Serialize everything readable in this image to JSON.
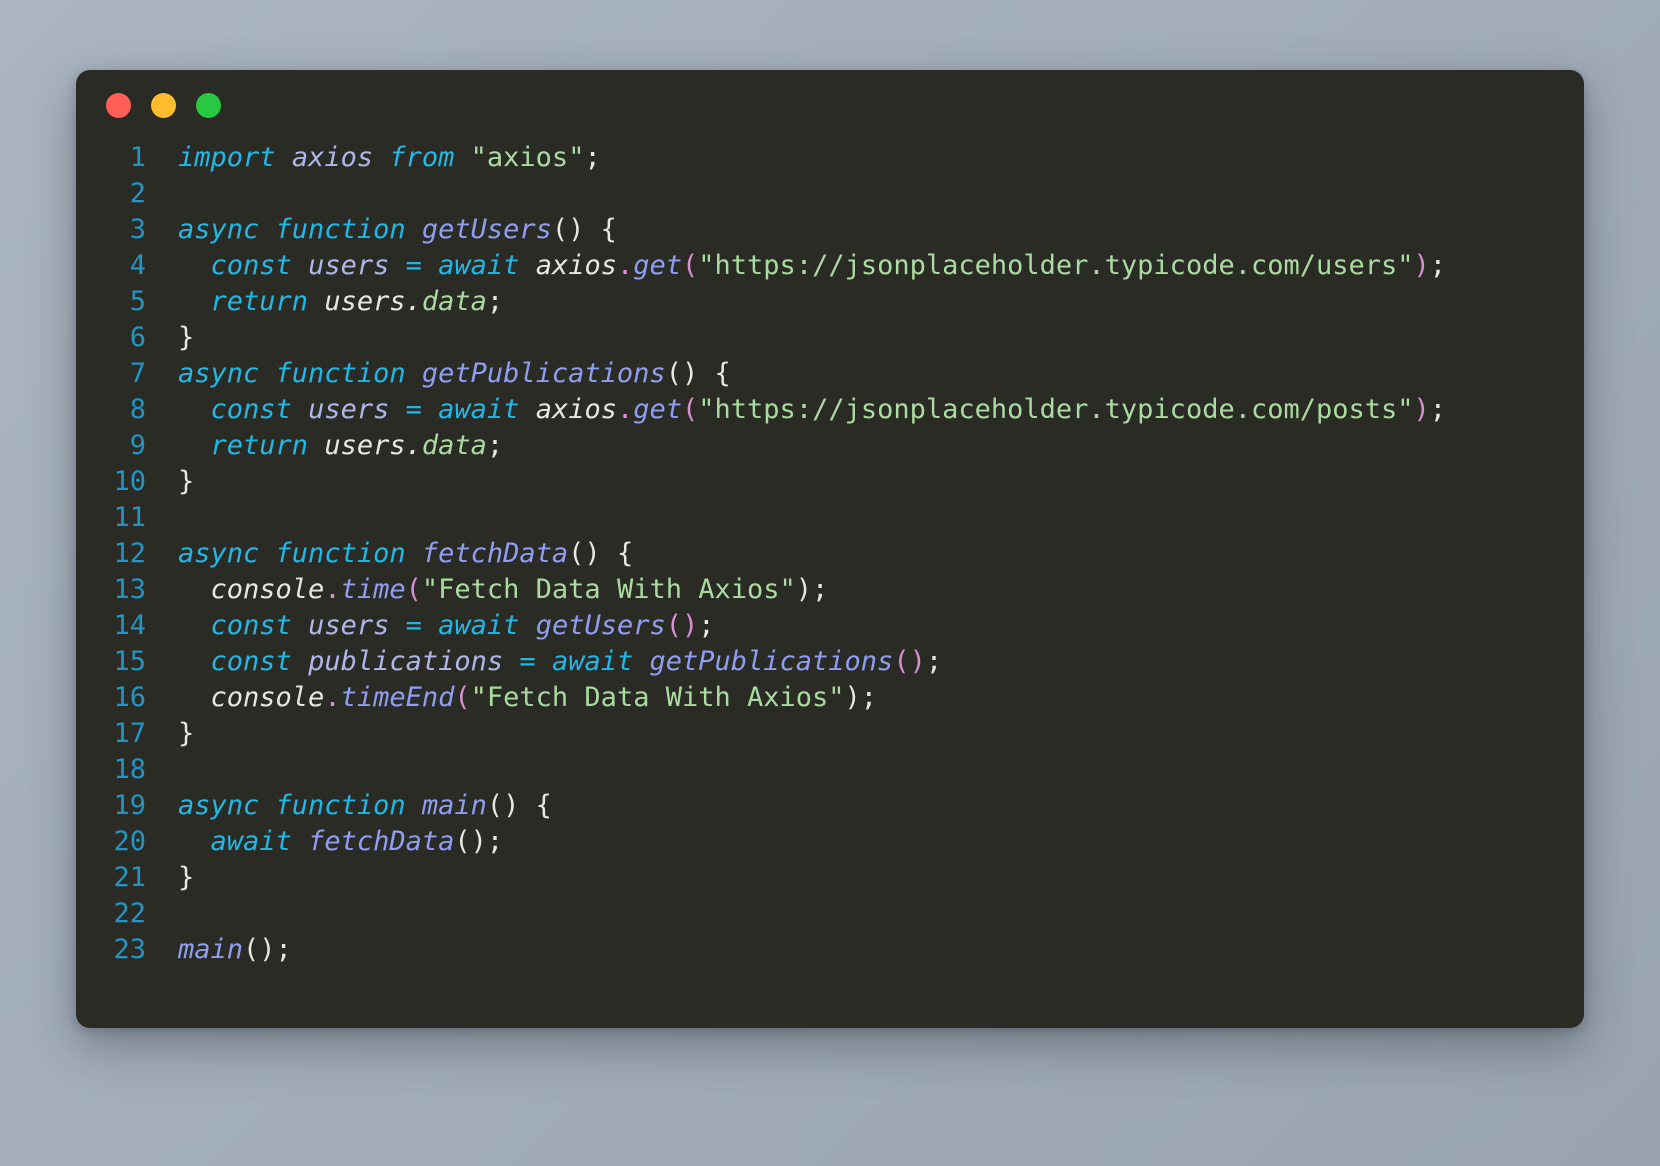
{
  "window": {
    "title_bar": {
      "buttons": [
        {
          "name": "close",
          "color": "#FF5F57",
          "label": "close-window-button"
        },
        {
          "name": "minimize",
          "color": "#FFBD2E",
          "label": "minimize-window-button"
        },
        {
          "name": "maximize",
          "color": "#28C840",
          "label": "maximize-window-button"
        }
      ]
    },
    "background_color": "#2b2b26",
    "page_background_color": "#a8b3bf"
  },
  "editor": {
    "language": "javascript",
    "line_number_color": "#2196c4",
    "first_line": 1,
    "last_line": 23,
    "lines": [
      {
        "number": "1",
        "text": "import axios from \"axios\";"
      },
      {
        "number": "2",
        "text": ""
      },
      {
        "number": "3",
        "text": "async function getUsers() {"
      },
      {
        "number": "4",
        "text": "  const users = await axios.get(\"https://jsonplaceholder.typicode.com/users\");"
      },
      {
        "number": "5",
        "text": "  return users.data;"
      },
      {
        "number": "6",
        "text": "}"
      },
      {
        "number": "7",
        "text": "async function getPublications() {"
      },
      {
        "number": "8",
        "text": "  const users = await axios.get(\"https://jsonplaceholder.typicode.com/posts\");"
      },
      {
        "number": "9",
        "text": "  return users.data;"
      },
      {
        "number": "10",
        "text": "}"
      },
      {
        "number": "11",
        "text": ""
      },
      {
        "number": "12",
        "text": "async function fetchData() {"
      },
      {
        "number": "13",
        "text": "  console.time(\"Fetch Data With Axios\");"
      },
      {
        "number": "14",
        "text": "  const users = await getUsers();"
      },
      {
        "number": "15",
        "text": "  const publications = await getPublications();"
      },
      {
        "number": "16",
        "text": "  console.timeEnd(\"Fetch Data With Axios\");"
      },
      {
        "number": "17",
        "text": "}"
      },
      {
        "number": "18",
        "text": ""
      },
      {
        "number": "19",
        "text": "async function main() {"
      },
      {
        "number": "20",
        "text": "  await fetchData();"
      },
      {
        "number": "21",
        "text": "}"
      },
      {
        "number": "22",
        "text": ""
      },
      {
        "number": "23",
        "text": "main();"
      }
    ],
    "tokens": [
      [
        {
          "t": "import",
          "c": "kw"
        },
        {
          "t": " ",
          "c": "punct"
        },
        {
          "t": "axios",
          "c": "var"
        },
        {
          "t": " ",
          "c": "punct"
        },
        {
          "t": "from",
          "c": "kw"
        },
        {
          "t": " ",
          "c": "punct"
        },
        {
          "t": "\"axios\"",
          "c": "str"
        },
        {
          "t": ";",
          "c": "punct"
        }
      ],
      [],
      [
        {
          "t": "async",
          "c": "kw"
        },
        {
          "t": " ",
          "c": "punct"
        },
        {
          "t": "function",
          "c": "kw"
        },
        {
          "t": " ",
          "c": "punct"
        },
        {
          "t": "getUsers",
          "c": "fn"
        },
        {
          "t": "() {",
          "c": "punct"
        }
      ],
      [
        {
          "t": "  ",
          "c": "punct"
        },
        {
          "t": "const",
          "c": "kw"
        },
        {
          "t": " ",
          "c": "punct"
        },
        {
          "t": "users",
          "c": "var"
        },
        {
          "t": " ",
          "c": "punct"
        },
        {
          "t": "=",
          "c": "kw"
        },
        {
          "t": " ",
          "c": "punct"
        },
        {
          "t": "await",
          "c": "kw"
        },
        {
          "t": " ",
          "c": "punct"
        },
        {
          "t": "axios",
          "c": "plain"
        },
        {
          "t": ".",
          "c": "mag"
        },
        {
          "t": "get",
          "c": "prop"
        },
        {
          "t": "(",
          "c": "mag"
        },
        {
          "t": "\"https://jsonplaceholder.typicode.com/users\"",
          "c": "str"
        },
        {
          "t": ")",
          "c": "mag"
        },
        {
          "t": ";",
          "c": "punct"
        }
      ],
      [
        {
          "t": "  ",
          "c": "punct"
        },
        {
          "t": "return",
          "c": "kw"
        },
        {
          "t": " ",
          "c": "punct"
        },
        {
          "t": "users",
          "c": "plain"
        },
        {
          "t": ".",
          "c": "plain"
        },
        {
          "t": "data",
          "c": "green"
        },
        {
          "t": ";",
          "c": "punct"
        }
      ],
      [
        {
          "t": "}",
          "c": "punct"
        }
      ],
      [
        {
          "t": "async",
          "c": "kw"
        },
        {
          "t": " ",
          "c": "punct"
        },
        {
          "t": "function",
          "c": "kw"
        },
        {
          "t": " ",
          "c": "punct"
        },
        {
          "t": "getPublications",
          "c": "fn"
        },
        {
          "t": "() {",
          "c": "punct"
        }
      ],
      [
        {
          "t": "  ",
          "c": "punct"
        },
        {
          "t": "const",
          "c": "kw"
        },
        {
          "t": " ",
          "c": "punct"
        },
        {
          "t": "users",
          "c": "var"
        },
        {
          "t": " ",
          "c": "punct"
        },
        {
          "t": "=",
          "c": "kw"
        },
        {
          "t": " ",
          "c": "punct"
        },
        {
          "t": "await",
          "c": "kw"
        },
        {
          "t": " ",
          "c": "punct"
        },
        {
          "t": "axios",
          "c": "plain"
        },
        {
          "t": ".",
          "c": "mag"
        },
        {
          "t": "get",
          "c": "prop"
        },
        {
          "t": "(",
          "c": "mag"
        },
        {
          "t": "\"https://jsonplaceholder.typicode.com/posts\"",
          "c": "str"
        },
        {
          "t": ")",
          "c": "mag"
        },
        {
          "t": ";",
          "c": "punct"
        }
      ],
      [
        {
          "t": "  ",
          "c": "punct"
        },
        {
          "t": "return",
          "c": "kw"
        },
        {
          "t": " ",
          "c": "punct"
        },
        {
          "t": "users",
          "c": "plain"
        },
        {
          "t": ".",
          "c": "plain"
        },
        {
          "t": "data",
          "c": "green"
        },
        {
          "t": ";",
          "c": "punct"
        }
      ],
      [
        {
          "t": "}",
          "c": "punct"
        }
      ],
      [],
      [
        {
          "t": "async",
          "c": "kw"
        },
        {
          "t": " ",
          "c": "punct"
        },
        {
          "t": "function",
          "c": "kw"
        },
        {
          "t": " ",
          "c": "punct"
        },
        {
          "t": "fetchData",
          "c": "fn"
        },
        {
          "t": "() {",
          "c": "punct"
        }
      ],
      [
        {
          "t": "  ",
          "c": "punct"
        },
        {
          "t": "console",
          "c": "plain"
        },
        {
          "t": ".",
          "c": "mag"
        },
        {
          "t": "time",
          "c": "prop"
        },
        {
          "t": "(",
          "c": "mag"
        },
        {
          "t": "\"Fetch Data With Axios\"",
          "c": "str"
        },
        {
          "t": ")",
          "c": "punct"
        },
        {
          "t": ";",
          "c": "punct"
        }
      ],
      [
        {
          "t": "  ",
          "c": "punct"
        },
        {
          "t": "const",
          "c": "kw"
        },
        {
          "t": " ",
          "c": "punct"
        },
        {
          "t": "users",
          "c": "var"
        },
        {
          "t": " ",
          "c": "punct"
        },
        {
          "t": "=",
          "c": "kw"
        },
        {
          "t": " ",
          "c": "punct"
        },
        {
          "t": "await",
          "c": "kw"
        },
        {
          "t": " ",
          "c": "punct"
        },
        {
          "t": "getUsers",
          "c": "fn"
        },
        {
          "t": "()",
          "c": "mag"
        },
        {
          "t": ";",
          "c": "punct"
        }
      ],
      [
        {
          "t": "  ",
          "c": "punct"
        },
        {
          "t": "const",
          "c": "kw"
        },
        {
          "t": " ",
          "c": "punct"
        },
        {
          "t": "publications",
          "c": "var"
        },
        {
          "t": " ",
          "c": "punct"
        },
        {
          "t": "=",
          "c": "kw"
        },
        {
          "t": " ",
          "c": "punct"
        },
        {
          "t": "await",
          "c": "kw"
        },
        {
          "t": " ",
          "c": "punct"
        },
        {
          "t": "getPublications",
          "c": "fn"
        },
        {
          "t": "()",
          "c": "mag"
        },
        {
          "t": ";",
          "c": "punct"
        }
      ],
      [
        {
          "t": "  ",
          "c": "punct"
        },
        {
          "t": "console",
          "c": "plain"
        },
        {
          "t": ".",
          "c": "mag"
        },
        {
          "t": "timeEnd",
          "c": "prop"
        },
        {
          "t": "(",
          "c": "mag"
        },
        {
          "t": "\"Fetch Data With Axios\"",
          "c": "str"
        },
        {
          "t": ")",
          "c": "punct"
        },
        {
          "t": ";",
          "c": "punct"
        }
      ],
      [
        {
          "t": "}",
          "c": "punct"
        }
      ],
      [],
      [
        {
          "t": "async",
          "c": "kw"
        },
        {
          "t": " ",
          "c": "punct"
        },
        {
          "t": "function",
          "c": "kw"
        },
        {
          "t": " ",
          "c": "punct"
        },
        {
          "t": "main",
          "c": "fn"
        },
        {
          "t": "() {",
          "c": "punct"
        }
      ],
      [
        {
          "t": "  ",
          "c": "punct"
        },
        {
          "t": "await",
          "c": "kw"
        },
        {
          "t": " ",
          "c": "punct"
        },
        {
          "t": "fetchData",
          "c": "fn"
        },
        {
          "t": "()",
          "c": "punct"
        },
        {
          "t": ";",
          "c": "punct"
        }
      ],
      [
        {
          "t": "}",
          "c": "punct"
        }
      ],
      [],
      [
        {
          "t": "main",
          "c": "fn"
        },
        {
          "t": "()",
          "c": "punct"
        },
        {
          "t": ";",
          "c": "punct"
        }
      ]
    ]
  },
  "palette": {
    "keyword": "#22b8e6",
    "function_name": "#8f9ef0",
    "variable": "#b0b6e8",
    "plain": "#e8e8e0",
    "string": "#aadba0",
    "punctuation": "#e8e8e0",
    "magenta_punct": "#d98fd3",
    "line_number": "#2196c4"
  }
}
